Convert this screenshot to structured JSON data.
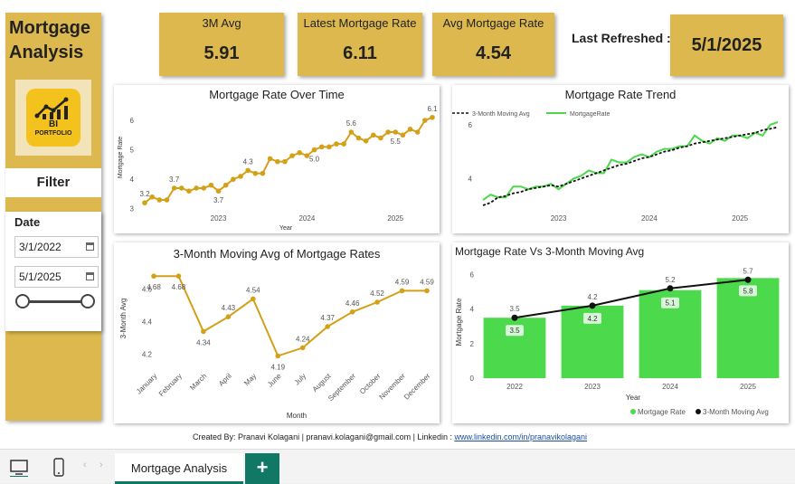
{
  "app": {
    "title": "Mortgage Analysis"
  },
  "logo": {
    "line1": "BI",
    "line2": "PORTFOLIO"
  },
  "filter": {
    "heading": "Filter",
    "date_label": "Date",
    "start": "3/1/2022",
    "end": "5/1/2025"
  },
  "kpis": [
    {
      "label": "3M Avg",
      "value": "5.91"
    },
    {
      "label": "Latest Mortgage Rate",
      "value": "6.11"
    },
    {
      "label": "Avg Mortgage Rate",
      "value": "4.54"
    }
  ],
  "refresh": {
    "label": "Last Refreshed :",
    "value": "5/1/2025"
  },
  "panels": {
    "rate_over_time": "Mortgage Rate Over Time",
    "trend": "Mortgage Rate Trend",
    "moving_avg": "3-Month Moving Avg of Mortgage Rates",
    "rate_vs_ma": "Mortgage Rate Vs 3-Month Moving Avg"
  },
  "footer": {
    "credit": "Created By: Pranavi Kolagani | pranavi.kolagani@gmail.com  | Linkedin : ",
    "link": "www.linkedin.com/in/pranavikolagani"
  },
  "tabs": [
    {
      "label": "Mortgage Analysis"
    }
  ],
  "icons": {
    "desktop": "desktop-icon",
    "mobile": "mobile-icon",
    "add": "+"
  },
  "colors": {
    "gold": "#ddb84e",
    "line_gold": "#d4a017",
    "green": "#4cd94c",
    "teal": "#117865"
  },
  "chart_data": [
    {
      "type": "line",
      "title": "Mortgage Rate Over Time",
      "xlabel": "Year",
      "ylabel": "Mortgage Rate",
      "x_ticks": [
        "2023",
        "2024",
        "2025"
      ],
      "y_ticks": [
        3,
        4,
        5,
        6
      ],
      "ylim": [
        2.9,
        6.4
      ],
      "values": [
        3.2,
        3.4,
        3.3,
        3.3,
        3.7,
        3.7,
        3.6,
        3.7,
        3.7,
        3.8,
        3.6,
        3.8,
        4.0,
        4.1,
        4.3,
        4.2,
        4.2,
        4.7,
        4.6,
        4.6,
        4.8,
        4.9,
        4.8,
        5.0,
        5.1,
        5.1,
        5.2,
        5.2,
        5.6,
        5.4,
        5.3,
        5.5,
        5.4,
        5.6,
        5.6,
        5.5,
        5.7,
        5.6,
        6.0,
        6.1
      ],
      "data_labels": [
        {
          "index": 0,
          "label": "3.2"
        },
        {
          "index": 4,
          "label": "3.7"
        },
        {
          "index": 10,
          "label": "3.7"
        },
        {
          "index": 14,
          "label": "4.3"
        },
        {
          "index": 23,
          "label": "5.0"
        },
        {
          "index": 28,
          "label": "5.6"
        },
        {
          "index": 34,
          "label": "5.5"
        },
        {
          "index": 39,
          "label": "6.1"
        }
      ]
    },
    {
      "type": "line",
      "title": "Mortgage Rate Trend",
      "x_ticks": [
        "2023",
        "2024",
        "2025"
      ],
      "y_ticks": [
        4,
        6
      ],
      "ylim": [
        2.9,
        6.4
      ],
      "series": [
        {
          "name": "3-Month Moving Avg",
          "values": [
            3.0,
            3.1,
            3.3,
            3.35,
            3.45,
            3.5,
            3.6,
            3.65,
            3.7,
            3.75,
            3.7,
            3.8,
            3.9,
            4.0,
            4.1,
            4.2,
            4.3,
            4.4,
            4.5,
            4.55,
            4.65,
            4.75,
            4.8,
            4.9,
            5.0,
            5.05,
            5.15,
            5.2,
            5.3,
            5.35,
            5.4,
            5.45,
            5.5,
            5.55,
            5.6,
            5.65,
            5.7,
            5.8,
            5.85,
            5.91
          ]
        },
        {
          "name": "MortgageRate",
          "values": [
            3.2,
            3.4,
            3.3,
            3.3,
            3.7,
            3.7,
            3.6,
            3.7,
            3.7,
            3.8,
            3.6,
            3.8,
            4.0,
            4.1,
            4.3,
            4.2,
            4.2,
            4.7,
            4.6,
            4.6,
            4.8,
            4.9,
            4.8,
            5.0,
            5.1,
            5.1,
            5.2,
            5.2,
            5.6,
            5.4,
            5.3,
            5.5,
            5.4,
            5.6,
            5.6,
            5.5,
            5.7,
            5.6,
            6.0,
            6.1
          ]
        }
      ]
    },
    {
      "type": "line",
      "title": "3-Month Moving Avg of Mortgage Rates",
      "xlabel": "Month",
      "ylabel": "3-Month Avg",
      "categories": [
        "January",
        "February",
        "March",
        "April",
        "May",
        "June",
        "July",
        "August",
        "September",
        "October",
        "November",
        "December"
      ],
      "values": [
        4.68,
        4.68,
        4.34,
        4.43,
        4.54,
        4.19,
        4.24,
        4.37,
        4.46,
        4.52,
        4.59,
        4.59
      ],
      "y_ticks": [
        "4.2",
        "4.4",
        "4.6"
      ],
      "ylim": [
        4.12,
        4.72
      ]
    },
    {
      "type": "bar",
      "title": "Mortgage Rate Vs 3-Month Moving Avg",
      "xlabel": "Year",
      "ylabel": "Mortgage Rate",
      "categories": [
        "2022",
        "2023",
        "2024",
        "2025"
      ],
      "y_ticks": [
        0,
        2,
        4,
        6
      ],
      "ylim": [
        0,
        6.5
      ],
      "series": [
        {
          "name": "Mortgage Rate",
          "values": [
            3.5,
            4.2,
            5.1,
            5.8
          ]
        },
        {
          "name": "3-Month Moving Avg",
          "values": [
            3.5,
            4.2,
            5.2,
            5.7
          ]
        }
      ]
    }
  ]
}
